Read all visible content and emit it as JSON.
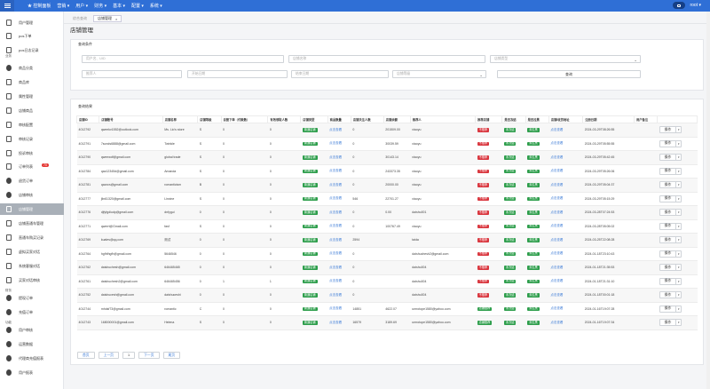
{
  "topbar": {
    "nav": [
      "★ 控制面板",
      "营销 ▾",
      "用户 ▾",
      "财务 ▾",
      "基本 ▾",
      "配置 ▾",
      "系统 ▾"
    ],
    "user": "root ▾"
  },
  "sidebar": {
    "items": [
      {
        "label": "用户管理"
      },
      {
        "label": "pos下单"
      },
      {
        "label": "pos日志记录"
      },
      {
        "label": "商品分类"
      },
      {
        "label": "商品库"
      },
      {
        "label": "属性管理"
      },
      {
        "label": "店铺商品"
      },
      {
        "label": "审核配置"
      },
      {
        "label": "审核记录"
      },
      {
        "label": "投诉审核"
      },
      {
        "label": "订单列表",
        "badge": "70"
      },
      {
        "label": "退货订单"
      },
      {
        "label": "店铺审核"
      },
      {
        "label": "店铺管理"
      },
      {
        "label": "店铺直通车管理"
      },
      {
        "label": "直通车购买记录"
      },
      {
        "label": "虚拟买家对话"
      },
      {
        "label": "系统客服对话"
      },
      {
        "label": "买家对话审核"
      },
      {
        "label": "提现订单"
      },
      {
        "label": "充值订单"
      },
      {
        "label": "用户审核"
      },
      {
        "label": "运营数据"
      },
      {
        "label": "代理商充值报表"
      },
      {
        "label": "用户报表"
      }
    ],
    "groups": [
      "业务",
      "财务",
      "功能"
    ]
  },
  "tabs": [
    {
      "label": "综合查询"
    },
    {
      "label": "店铺管理",
      "close": "×"
    }
  ],
  "page": {
    "title": "店铺管理"
  },
  "search": {
    "title": "查询条件",
    "uid_placeholder": "用户名、UID",
    "store_placeholder": "店铺名称",
    "type_placeholder": "店铺类型",
    "referrer_placeholder": "推荐人",
    "start_placeholder": "开始日期",
    "end_placeholder": "结束日期",
    "level_placeholder": "店铺等级",
    "query_label": "查询"
  },
  "results": {
    "title": "查询结果",
    "headers": [
      "店铺ID",
      "店铺账号",
      "店铺名称",
      "店铺等级",
      "自营下单（付款数）",
      "有效领取人数",
      "店铺类型",
      "商品数量",
      "店铺关注人数",
      "店铺余额",
      "推荐人",
      "推荐店铺",
      "是否冻结",
      "是否拉黑",
      "店铺/收货地址",
      "注册日期",
      "用户备注",
      ""
    ],
    "rows": [
      {
        "id": "4012792",
        "account": "qweekv1552@outlook.com",
        "name": "Ms. Lio's store",
        "level": "S",
        "orders": "0",
        "recv": "0",
        "goods": "0",
        "followers": "",
        "balance": "201509.00",
        "ref": "xiaoyu",
        "date": "2024-03-29T08:26:55"
      },
      {
        "id": "4012791",
        "account": "7sonds6888@gmail.com",
        "name": "Twinkle",
        "level": "S",
        "orders": "0",
        "recv": "0",
        "goods": "0",
        "followers": "",
        "balance": "30039.59",
        "ref": "xiaoyu",
        "date": "2024-03-29T05:55:55"
      },
      {
        "id": "4012790",
        "account": "qweewdf@gmail.com",
        "name": "global trade",
        "level": "S",
        "orders": "0",
        "recv": "0",
        "goods": "0",
        "followers": "",
        "balance": "30143.14",
        "ref": "xiaoyu",
        "date": "2024-03-29T05:42:45"
      },
      {
        "id": "4012784",
        "account": "qaz12345d@gmail.com",
        "name": "Amanda",
        "level": "S",
        "orders": "0",
        "recv": "0",
        "goods": "0",
        "followers": "",
        "balance": "243373.35",
        "ref": "xiaoyu",
        "date": "2024-03-29T05:26:06"
      },
      {
        "id": "4012781",
        "account": "qazxcs@gmail.com",
        "name": "romanticism",
        "level": "B",
        "orders": "0",
        "recv": "0",
        "goods": "0",
        "followers": "",
        "balance": "20000.00",
        "ref": "xiaoyu",
        "date": "2024-03-29T05:04:37"
      },
      {
        "id": "4012777",
        "account": "jlin61320@gmail.com",
        "name": "Linxine",
        "level": "S",
        "orders": "0",
        "recv": "0",
        "goods": "546",
        "followers": "",
        "balance": "22701.27",
        "ref": "xiaoyu",
        "date": "2024-03-29T05:15:29"
      },
      {
        "id": "4012776",
        "account": "djfyfgdiudp@gmail.com",
        "name": "dnfygui",
        "level": "0",
        "orders": "0",
        "recv": "0",
        "goods": "0",
        "followers": "",
        "balance": "0.00",
        "ref": "daishu001",
        "date": "2024-03-28T07:24:53"
      },
      {
        "id": "4012771",
        "account": "qwerrt@Gmail.com",
        "name": "fasf",
        "level": "S",
        "orders": "0",
        "recv": "0",
        "goods": "0",
        "followers": "",
        "balance": "100767.49",
        "ref": "xiaoyu",
        "date": "2024-03-28T05:05:02"
      },
      {
        "id": "4012769",
        "account": "kuales@qq.com",
        "name": "测试",
        "level": "0",
        "orders": "0",
        "recv": "0",
        "goods": "2594",
        "followers": "",
        "balance": "",
        "ref": "taida",
        "date": "2024-03-25T22:08:28"
      },
      {
        "id": "4012764",
        "account": "hgfhfhgfh@gmail.com",
        "name": "5646546",
        "level": "0",
        "orders": "0",
        "recv": "0",
        "goods": "0",
        "followers": "",
        "balance": "",
        "ref": "daishuchesh2@gmail.com",
        "date": "2024-01-18T23:10:43"
      },
      {
        "id": "4012762",
        "account": "daishuchesh@gmail.com",
        "name": "646465465",
        "level": "0",
        "orders": "0",
        "recv": "0",
        "goods": "0",
        "followers": "",
        "balance": "",
        "ref": "daishu004",
        "date": "2024-01-18T21:35:53"
      },
      {
        "id": "4012761",
        "account": "daishuchesh2@gmail.com",
        "name": "646465456",
        "level": "0",
        "orders": "1",
        "recv": "1",
        "goods": "0",
        "followers": "",
        "balance": "",
        "ref": "daishu004",
        "date": "2024-01-18T21:31:10"
      },
      {
        "id": "4012752",
        "account": "daishucesh@gmail.com",
        "name": "daishuceshi",
        "level": "0",
        "orders": "0",
        "recv": "0",
        "goods": "0",
        "followers": "",
        "balance": "",
        "ref": "daishu004",
        "date": "2024-01-18T00:01:18"
      },
      {
        "id": "4012744",
        "account": "mhdsf73@gmail.com",
        "name": "romantic",
        "level": "C",
        "orders": "0",
        "recv": "0",
        "goods": "14851",
        "followers": "4622.07",
        "balance": "",
        "ref": "umrotope1580@yahoo.com",
        "date": "2024-01-16T19:07:28",
        "recommended": true
      },
      {
        "id": "4012743",
        "account": "168000001@gmail.com",
        "name": "Helena",
        "level": "S",
        "orders": "0",
        "recv": "0",
        "goods": "16579",
        "followers": "3189.69",
        "balance": "",
        "ref": "umrotope1580@yahoo.com",
        "date": "2024-01-16T19:07:34",
        "recommended": true
      }
    ],
    "type_tag": "普通店铺",
    "goods_link": "点击查看",
    "rec_no": "不推荐",
    "rec_yes": "店铺推荐",
    "freeze": "未冻结",
    "black": "未拉黑",
    "addr_link": "点击查看",
    "op_label": "操作"
  },
  "pager": [
    "首页",
    "上一页",
    "1",
    "下一页",
    "尾页"
  ]
}
